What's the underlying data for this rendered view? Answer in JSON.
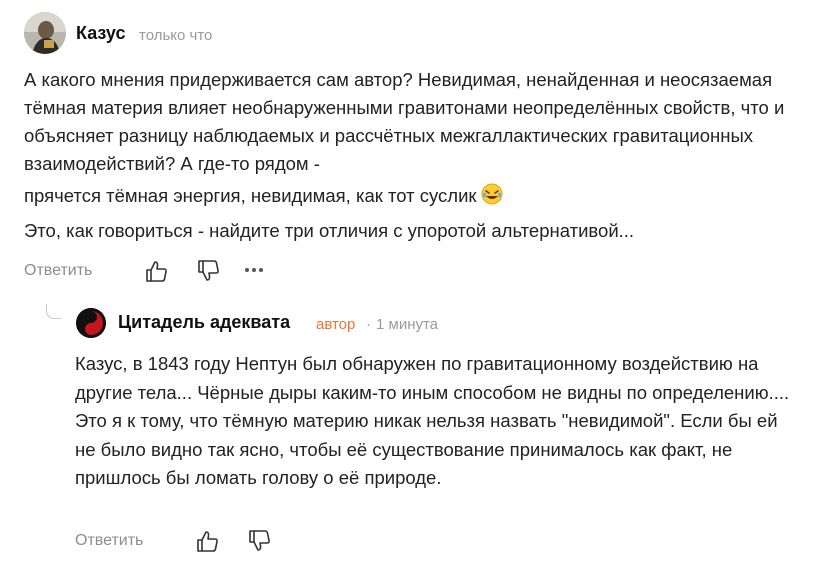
{
  "comment": {
    "author": "Казус",
    "time": "только что",
    "paragraphs": [
      "А какого мнения придерживается сам автор? Невидимая, ненайденная и неосязаемая тёмная материя влияет необнаруженными гравитонами неопределённых свойств, что и объясняет разницу наблюдаемых и рассчётных межгаллактических гравитационных взаимодействий? А где-то рядом -",
      "прячется тёмная энергия, невидимая, как тот суслик",
      "Это, как говориться - найдите три отличия с упоротой альтернативой..."
    ],
    "actions": {
      "reply_label": "Ответить",
      "like_icon": "thumbs-up-icon",
      "dislike_icon": "thumbs-down-icon",
      "more_icon": "more-dots-icon"
    }
  },
  "reply": {
    "author": "Цитадель адеквата",
    "author_tag": "автор",
    "separator": "·",
    "time": "1 минута",
    "paragraphs": [
      "Казус, в 1843 году Нептун был обнаружен по гравитационному воздействию на другие тела... Чёрные дыры каким-то иным способом не видны по определению.... Это я к тому, что тёмную материю никак нельзя назвать \"невидимой\". Если бы ей не было видно так ясно, чтобы её существование принималось как факт, не пришлось бы ломать голову о её природе."
    ],
    "actions": {
      "reply_label": "Ответить",
      "like_icon": "thumbs-up-icon",
      "dislike_icon": "thumbs-down-icon"
    }
  },
  "colors": {
    "accent_author": "#f0742c",
    "muted_text": "#9a9a9a",
    "body_text": "#222222"
  }
}
